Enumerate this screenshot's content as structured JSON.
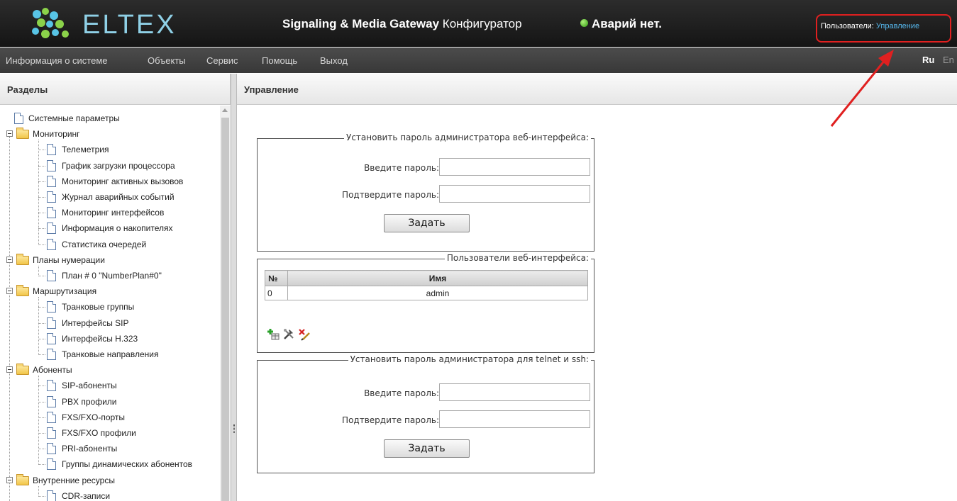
{
  "header": {
    "logo_text": "ELTEX",
    "title_bold": "Signaling & Media Gateway",
    "title_rest": "Конфигуратор",
    "alarm_text": "Аварий нет.",
    "users_label": "Пользователи:",
    "users_link": "Управление"
  },
  "menu": {
    "items": [
      "Информация о системе",
      "Объекты",
      "Сервис",
      "Помощь",
      "Выход"
    ],
    "lang_ru": "Ru",
    "lang_en": "En"
  },
  "left_panel": {
    "title": "Разделы",
    "tree": [
      {
        "label": "Системные параметры",
        "type": "doc",
        "level": 0
      },
      {
        "label": "Мониторинг",
        "type": "folder",
        "level": 0
      },
      {
        "label": "Телеметрия",
        "type": "doc",
        "level": 1
      },
      {
        "label": "График загрузки процессора",
        "type": "doc",
        "level": 1
      },
      {
        "label": "Мониторинг активных вызовов",
        "type": "doc",
        "level": 1
      },
      {
        "label": "Журнал аварийных событий",
        "type": "doc",
        "level": 1
      },
      {
        "label": "Мониторинг интерфейсов",
        "type": "doc",
        "level": 1
      },
      {
        "label": "Информация о накопителях",
        "type": "doc",
        "level": 1
      },
      {
        "label": "Статистика очередей",
        "type": "doc",
        "level": 1
      },
      {
        "label": "Планы нумерации",
        "type": "folder",
        "level": 0
      },
      {
        "label": "План # 0 \"NumberPlan#0\"",
        "type": "doc",
        "level": 1
      },
      {
        "label": "Маршрутизация",
        "type": "folder",
        "level": 0
      },
      {
        "label": "Транковые группы",
        "type": "doc",
        "level": 1
      },
      {
        "label": "Интерфейсы SIP",
        "type": "doc",
        "level": 1
      },
      {
        "label": "Интерфейсы H.323",
        "type": "doc",
        "level": 1
      },
      {
        "label": "Транковые направления",
        "type": "doc",
        "level": 1
      },
      {
        "label": "Абоненты",
        "type": "folder",
        "level": 0
      },
      {
        "label": "SIP-абоненты",
        "type": "doc",
        "level": 1
      },
      {
        "label": "PBX профили",
        "type": "doc",
        "level": 1
      },
      {
        "label": "FXS/FXO-порты",
        "type": "doc",
        "level": 1
      },
      {
        "label": "FXS/FXO профили",
        "type": "doc",
        "level": 1
      },
      {
        "label": "PRI-абоненты",
        "type": "doc",
        "level": 1
      },
      {
        "label": "Группы динамических абонентов",
        "type": "doc",
        "level": 1
      },
      {
        "label": "Внутренние ресурсы",
        "type": "folder",
        "level": 0
      },
      {
        "label": "CDR-записи",
        "type": "doc",
        "level": 1
      }
    ]
  },
  "right_panel": {
    "title": "Управление",
    "web_password": {
      "legend": "Установить пароль администратора веб-интерфейса:",
      "enter_label": "Введите пароль:",
      "confirm_label": "Подтвердите пароль:",
      "enter_value": "",
      "confirm_value": "",
      "button": "Задать"
    },
    "web_users": {
      "legend": "Пользователи веб-интерфейса:",
      "columns": [
        "№",
        "Имя"
      ],
      "rows": [
        [
          "0",
          "admin"
        ]
      ],
      "icons": [
        "add-user-icon",
        "edit-tools-icon",
        "delete-user-icon"
      ]
    },
    "telnet_password": {
      "legend": "Установить пароль администратора для telnet и ssh:",
      "enter_label": "Введите пароль:",
      "confirm_label": "Подтвердите пароль:",
      "enter_value": "",
      "confirm_value": "",
      "button": "Задать"
    }
  },
  "colors": {
    "header_bg": "#1f1f1f",
    "menubar_bg": "#424242",
    "link": "#56b8ee",
    "highlight": "#e02020",
    "logo": "#8fd0e6",
    "status_ok": "#2e9a10"
  }
}
